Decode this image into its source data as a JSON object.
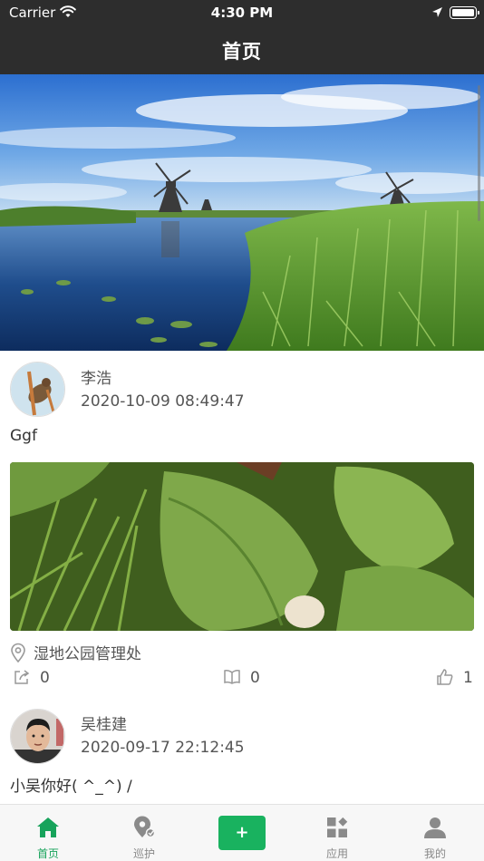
{
  "status_bar": {
    "carrier": "Carrier",
    "time": "4:30 PM"
  },
  "nav": {
    "title": "首页"
  },
  "banner": {
    "image": "windmills-landscape"
  },
  "posts": [
    {
      "author": "李浩",
      "time": "2020-10-09 08:49:47",
      "text": "Ggf",
      "has_photo": true,
      "location": "湿地公园管理处",
      "shares": "0",
      "reads": "0",
      "likes": "1"
    },
    {
      "author": "吴桂建",
      "time": "2020-09-17 22:12:45",
      "text": "小吴你好( ^_^) /"
    }
  ],
  "tabs": [
    {
      "label": "首页",
      "icon": "home-icon",
      "active": true
    },
    {
      "label": "巡护",
      "icon": "patrol-icon",
      "active": false
    },
    {
      "label": "+",
      "icon": "add-icon",
      "active": false
    },
    {
      "label": "应用",
      "icon": "apps-icon",
      "active": false
    },
    {
      "label": "我的",
      "icon": "profile-icon",
      "active": false
    }
  ],
  "colors": {
    "accent": "#19b25f",
    "nav_bg": "#2d2d2d"
  }
}
